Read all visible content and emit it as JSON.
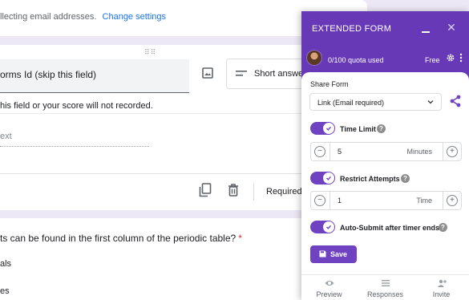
{
  "form": {
    "email_note": "llecting email addresses.",
    "change_settings_link": "Change settings",
    "question1": {
      "title": "orms Id (skip this field)",
      "type_label": "Short answer",
      "description": "his field or your score will not recorded.",
      "answer_hint": "ext",
      "required_label": "Required"
    },
    "question2": {
      "text": "ts can be found in the first column of the periodic table?",
      "required_mark": "*",
      "option1": "als",
      "option2": "es"
    }
  },
  "extension": {
    "title": "EXTENDED FORM",
    "quota_text": "0/100 quota used",
    "plan": "Free",
    "share_form_label": "Share Form",
    "share_select_value": "Link (Email required)",
    "time_limit": {
      "label": "Time Limit",
      "enabled": true,
      "value": "5",
      "unit": "Minutes"
    },
    "restrict_attempts": {
      "label": "Restrict Attempts",
      "enabled": true,
      "value": "1",
      "unit": "Time"
    },
    "auto_submit": {
      "label": "Auto-Submit after timer ends",
      "enabled": true
    },
    "save_label": "Save",
    "nav": {
      "preview": "Preview",
      "responses": "Responses",
      "invite": "Invite"
    },
    "colors": {
      "header": "#6839b7",
      "accent": "#6f42c1"
    }
  }
}
